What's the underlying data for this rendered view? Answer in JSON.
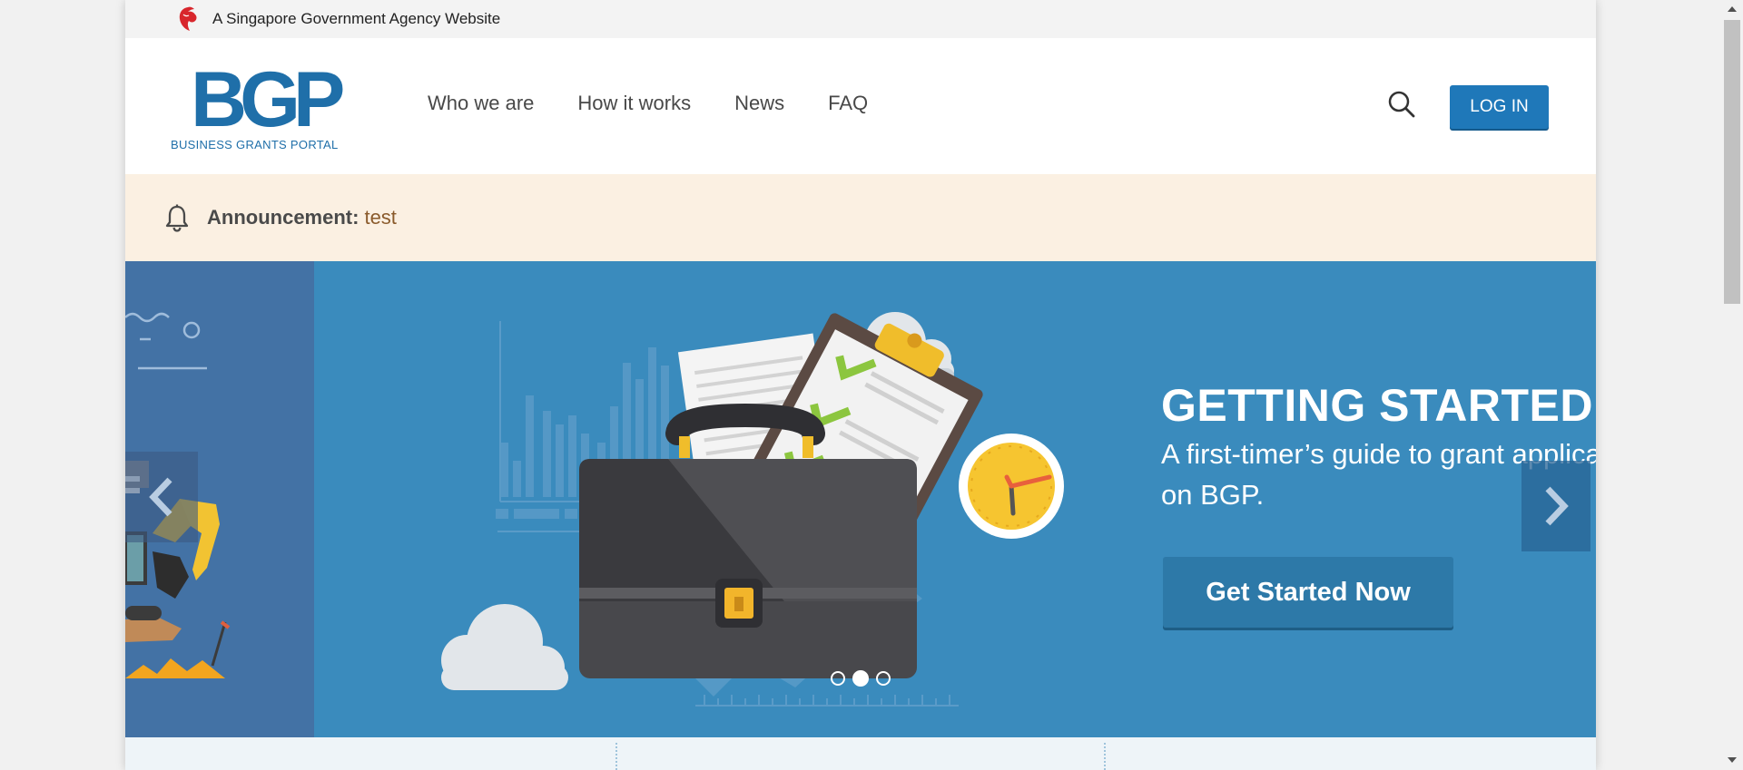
{
  "masthead": {
    "text": "A Singapore Government Agency Website",
    "icon": "lion-head-icon"
  },
  "header": {
    "logo_main": "BGP",
    "logo_sub": "BUSINESS GRANTS PORTAL",
    "nav": [
      {
        "label": "Who we are"
      },
      {
        "label": "How it works"
      },
      {
        "label": "News"
      },
      {
        "label": "FAQ"
      }
    ],
    "search_icon": "search-icon",
    "login_label": "LOG IN"
  },
  "announcement": {
    "label": "Announcement:",
    "text": "test",
    "icon": "bell-icon"
  },
  "carousel": {
    "title": "GETTING STARTED",
    "subtitle": "A first-timer’s guide to grant applications on BGP.",
    "cta_label": "Get Started Now",
    "slide_count": 3,
    "active_slide": 2
  },
  "colors": {
    "brand_blue": "#1f78b9",
    "carousel_bg": "#3a8bbd",
    "announcement_bg": "#fbf0e2",
    "masthead_bg": "#f3f3f3"
  }
}
